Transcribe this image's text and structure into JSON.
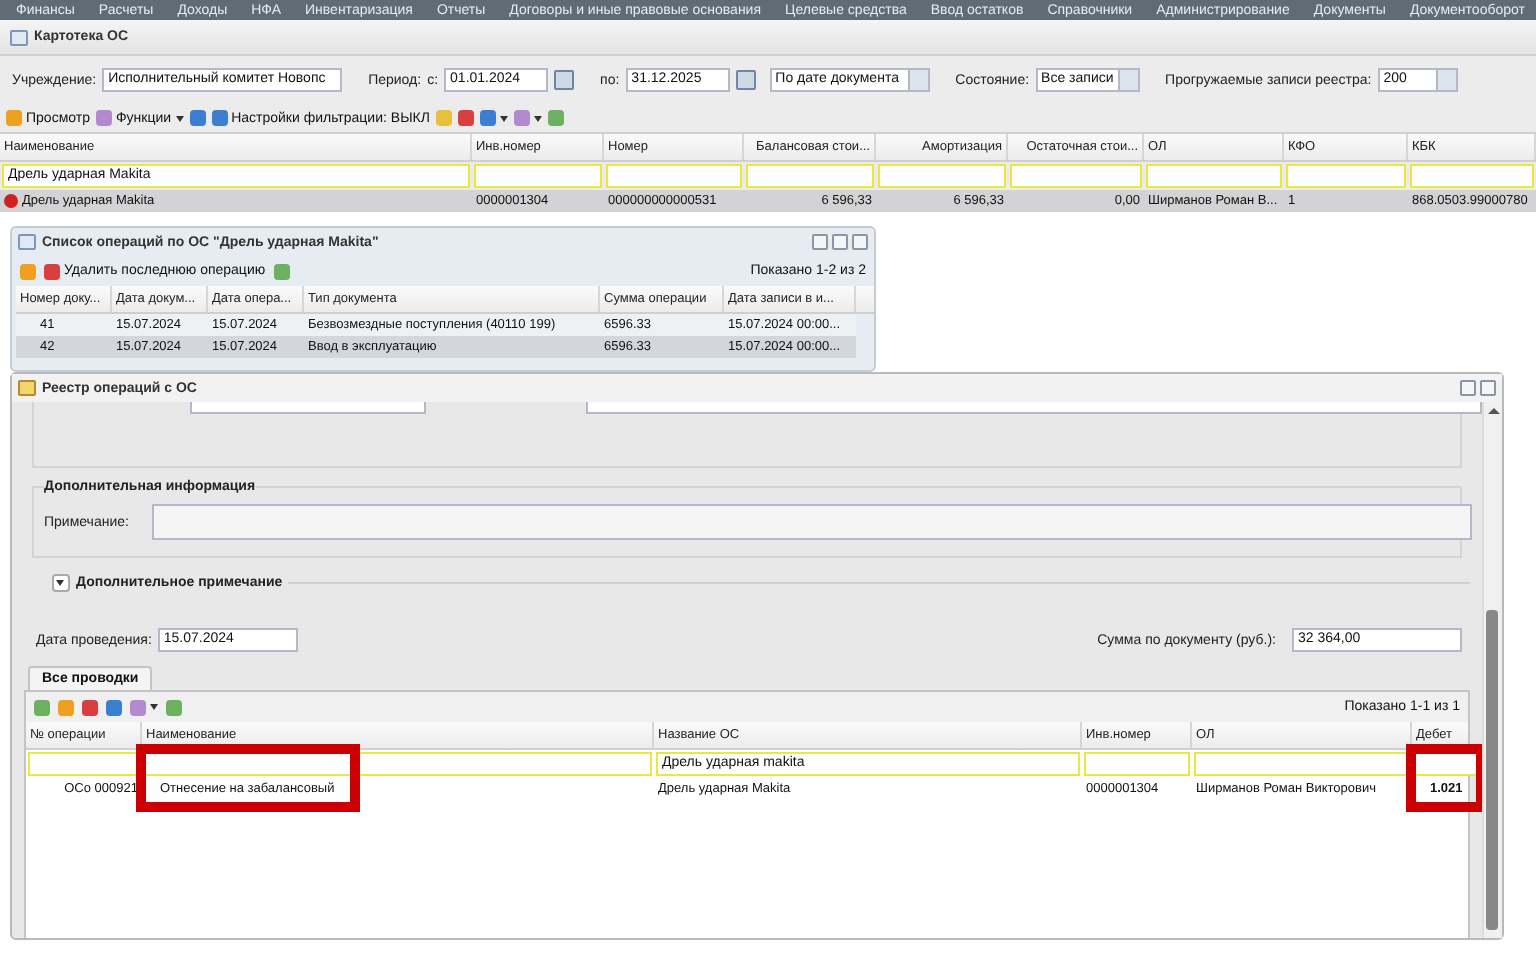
{
  "menu": [
    "Финансы",
    "Расчеты",
    "Доходы",
    "НФА",
    "Инвентаризация",
    "Отчеты",
    "Договоры и иные правовые основания",
    "Целевые средства",
    "Ввод остатков",
    "Справочники",
    "Администрирование",
    "Документы",
    "Документооборот"
  ],
  "main_window": {
    "title": "Картотека ОС",
    "filters": {
      "institution_label": "Учреждение:",
      "institution": "Исполнительный комитет Новопс",
      "period_label": "Период:",
      "from_label": "с:",
      "from": "01.01.2024",
      "to_label": "по:",
      "to": "31.12.2025",
      "date_mode": "По дате документа",
      "state_label": "Состояние:",
      "state": "Все записи",
      "records_label": "Прогружаемые записи реестра:",
      "records": "200"
    },
    "toolbar": [
      {
        "kind": "labeled",
        "label": "Просмотр",
        "dropdown": false
      },
      {
        "kind": "labeled",
        "label": "Функции",
        "dropdown": true
      },
      {
        "kind": "icon",
        "dropdown": false
      },
      {
        "kind": "labeled",
        "label": "Настройки фильтрации: ВЫКЛ",
        "dropdown": false
      },
      {
        "kind": "icon",
        "dropdown": false
      },
      {
        "kind": "icon",
        "dropdown": false
      },
      {
        "kind": "icon",
        "dropdown": true
      },
      {
        "kind": "icon",
        "dropdown": true
      },
      {
        "kind": "icon",
        "dropdown": false
      }
    ],
    "table": {
      "columns": [
        {
          "title": "Наименование",
          "filter": "Дрель ударная Makita"
        },
        {
          "title": "Инв.номер"
        },
        {
          "title": "Номер"
        },
        {
          "title": "Балансовая стои..."
        },
        {
          "title": "Амортизация"
        },
        {
          "title": "Остаточная стои..."
        },
        {
          "title": "ОЛ"
        },
        {
          "title": "КФО"
        },
        {
          "title": "КБК"
        }
      ],
      "rows": [
        {
          "selected": true,
          "cells": [
            "Дрель ударная Makita",
            "0000001304",
            "000000000000531",
            "6 596,33",
            "6 596,33",
            "0,00",
            "Ширманов Роман В...",
            "1",
            "868.0503.99000780"
          ]
        }
      ]
    }
  },
  "operations_dialog": {
    "title": "Список операций по ОС \"Дрель ударная Makita\"",
    "delete_label": "Удалить последнюю операцию",
    "pager": "Показано 1-2 из 2",
    "columns": [
      "Номер доку...",
      "Дата докум...",
      "Дата опера...",
      "Тип документа",
      "Сумма операции",
      "Дата записи в и..."
    ],
    "rows": [
      {
        "selected": false,
        "cells": [
          "41",
          "15.07.2024",
          "15.07.2024",
          "Безвозмездные поступления (40110 199)",
          "6596.33",
          "15.07.2024 00:00..."
        ]
      },
      {
        "selected": true,
        "cells": [
          "42",
          "15.07.2024",
          "15.07.2024",
          "Ввод в эксплуатацию",
          "6596.33",
          "15.07.2024 00:00..."
        ]
      }
    ]
  },
  "register_dialog": {
    "title": "Реестр операций с ОС",
    "section_title": "Дополнительная информация",
    "note_label": "Примечание:",
    "extra_note": {
      "label": "Дополнительное примечание",
      "expanded": false
    },
    "date_label": "Дата проведения:",
    "date": "15.07.2024",
    "sum_label": "Сумма по документу (руб.):",
    "sum": "32 364,00",
    "tabs": [
      {
        "label": "Все проводки",
        "selected": true
      }
    ],
    "pager": "Показано 1-1 из 1",
    "columns": [
      {
        "title": "№ операции",
        "highlighted": false,
        "bold": false
      },
      {
        "title": "Наименование",
        "highlighted": true,
        "bold": false
      },
      {
        "title": "Название ОС",
        "filter": "Дрель ударная makita",
        "highlighted": false,
        "bold": false
      },
      {
        "title": "Инв.номер",
        "highlighted": false,
        "bold": false
      },
      {
        "title": "ОЛ",
        "highlighted": false,
        "bold": false
      },
      {
        "title": "Дебет",
        "highlighted": true,
        "bold": true
      }
    ],
    "rows": [
      {
        "cells": [
          "ОСо 000921",
          "Отнесение на забалансовый",
          "Дрель ударная Makita",
          "0000001304",
          "Ширманов Роман Викторович",
          "1.021"
        ]
      }
    ]
  }
}
